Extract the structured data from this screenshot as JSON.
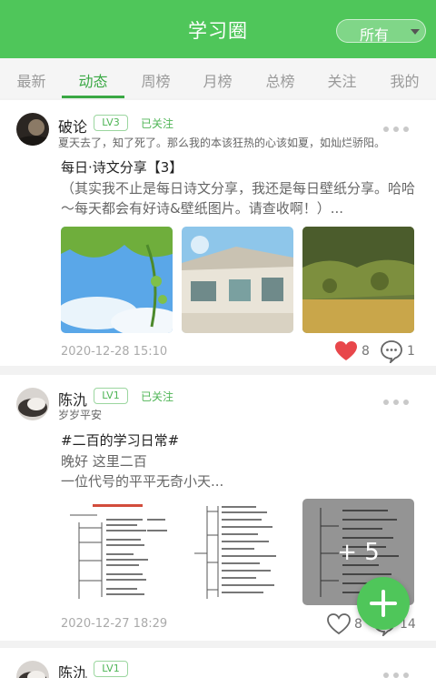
{
  "header": {
    "title": "学习圈",
    "filter_label": "所有"
  },
  "tabs": [
    {
      "label": "最新"
    },
    {
      "label": "动态"
    },
    {
      "label": "周榜"
    },
    {
      "label": "月榜"
    },
    {
      "label": "总榜"
    },
    {
      "label": "关注"
    },
    {
      "label": "我的"
    }
  ],
  "active_tab": "动态",
  "colors": {
    "brand": "#4fc65a",
    "accent": "#3aa844",
    "like": "#e8474b"
  },
  "posts": [
    {
      "user": "破论",
      "level": "LV3",
      "follow": "已关注",
      "signature": "夏天去了，知了死了。那么我的本该狂热的心该如夏，如灿烂骄阳。",
      "title": "每日·诗文分享【3】",
      "body": "（其实我不止是每日诗文分享，我还是每日壁纸分享。哈哈～每天都会有好诗&壁纸图片。请查收啊！）...",
      "time": "2020-12-28 15:10",
      "likes": "8",
      "comments": "1",
      "liked": true
    },
    {
      "user": "陈氿",
      "level": "LV1",
      "follow": "已关注",
      "signature": "岁岁平安",
      "title": "#二百的学习日常#",
      "body_lines": [
        "晚好 这里二百",
        "一位代号的平平无奇小天..."
      ],
      "time": "2020-12-27 18:29",
      "likes": "8",
      "comments": "14",
      "liked": false,
      "more_images": "+ 5"
    },
    {
      "user": "陈氿",
      "level": "LV1"
    }
  ]
}
